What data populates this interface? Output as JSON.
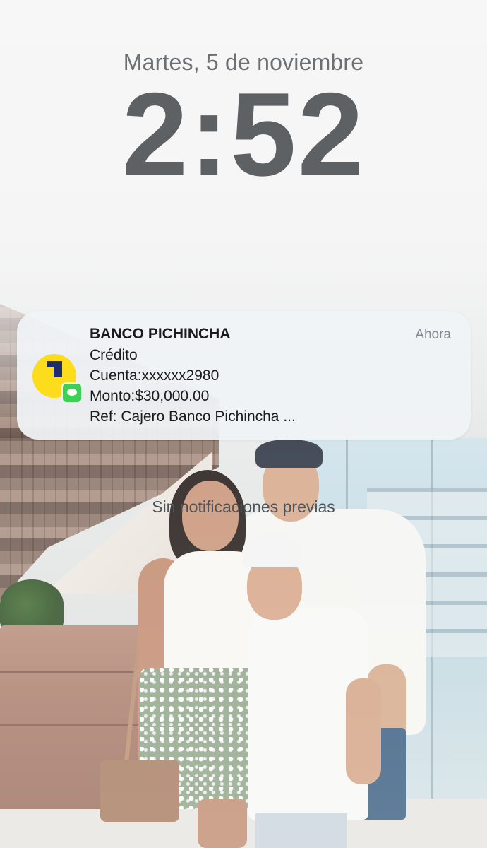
{
  "lock_screen": {
    "date": "Martes, 5 de noviembre",
    "time": "2:52",
    "empty_state": "Sin notificaciones previas"
  },
  "notification": {
    "app": "BANCO PICHINCHA",
    "timestamp": "Ahora",
    "lines": [
      "Crédito",
      "Cuenta:xxxxxx2980",
      "Monto:$30,000.00",
      "Ref: Cajero Banco Pichincha ..."
    ],
    "icon": "banco-pichincha-logo-icon",
    "source_badge": "messages-icon",
    "colors": {
      "brand_yellow": "#fddc1b",
      "brand_navy": "#1e2e6b",
      "messages_green": "#3fcf55"
    }
  },
  "wallpaper": {
    "description_icon": "family-photo-wallpaper"
  }
}
